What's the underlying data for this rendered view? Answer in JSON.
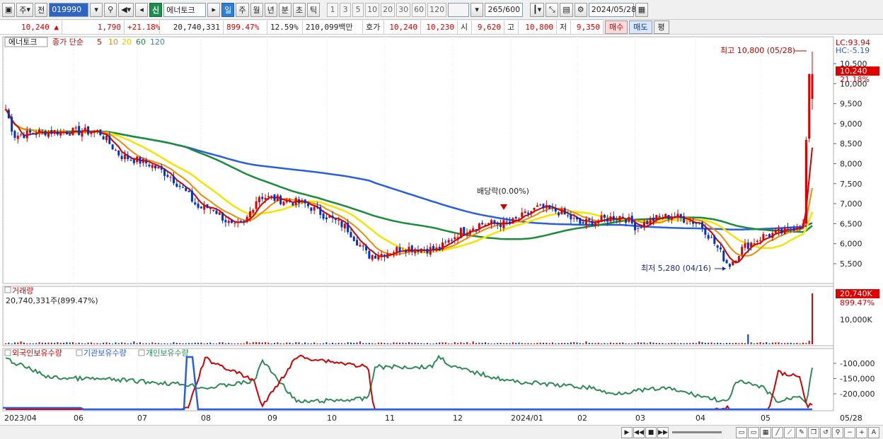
{
  "toolbar": {
    "type_label": "주",
    "prev_label": "전",
    "code_value": "019990",
    "badge_new": "신",
    "stock_name": "에너토크",
    "periods": [
      "일",
      "주",
      "월",
      "년",
      "분",
      "초",
      "틱"
    ],
    "minute_options": [
      "1",
      "3",
      "5",
      "10",
      "20",
      "30",
      "60",
      "120"
    ],
    "count_value": "265",
    "count_total": "/600",
    "date_value": "2024/05/28"
  },
  "quote": {
    "price": "10,240",
    "change": "1,790",
    "change_pct": "+21.18%",
    "volume": "20,740,331",
    "vol_ratio": "899.47%",
    "turnover": "12.59%",
    "amount": "210,099백만",
    "ask_label": "호가",
    "ask": "10,240",
    "bid": "10,230",
    "open_label": "시",
    "open": "9,620",
    "high_label": "고",
    "high": "10,800",
    "low_label": "저",
    "low": "9,350",
    "buy_label": "매수",
    "sell_label": "매도",
    "eval_label": "평"
  },
  "price_panel": {
    "stock_tag": "에너토크",
    "legend_prefix": "종가 단순",
    "ma_periods": [
      "5",
      "10",
      "20",
      "60",
      "120"
    ],
    "lc_label": "LC:93.94",
    "hc_label": "HC:-5.19",
    "y_ticks": [
      "10,500",
      "10,000",
      "9,500",
      "9,000",
      "8,500",
      "8,000",
      "7,500",
      "7,000",
      "6,500",
      "6,000",
      "5,500"
    ],
    "current_tag": "10,240",
    "pct_tag": "21.18%",
    "high_annotation": "최고 10,800 (05/28)",
    "low_annotation": "최저 5,280 (04/16)",
    "dividend_annotation": "배당락(0.00%)"
  },
  "volume_panel": {
    "title": "거래량",
    "value_text": "20,740,331주(899.47%)",
    "tag": "20,740K",
    "pct": "899.47%",
    "y_tick": "10,000K"
  },
  "holders_panel": {
    "legend": [
      "외국인보유수량",
      "기관보유수량",
      "개인보유수량"
    ],
    "y_ticks": [
      "-100,000",
      "-150,000",
      "-200,000"
    ]
  },
  "x_axis": {
    "labels": [
      "2023/04",
      "06",
      "07",
      "08",
      "09",
      "10",
      "11",
      "12",
      "2024/01",
      "02",
      "03",
      "04",
      "05"
    ],
    "end_label": "05/28"
  },
  "colors": {
    "up": "#e00000",
    "down": "#0033cc",
    "ma5": "#d40000",
    "ma10": "#f08a00",
    "ma20": "#f5e400",
    "ma60": "#1a8c3a",
    "ma120": "#2a5ee0",
    "foreign": "#d40000",
    "institution": "#2a5ee0",
    "individual": "#2e8b57"
  }
}
